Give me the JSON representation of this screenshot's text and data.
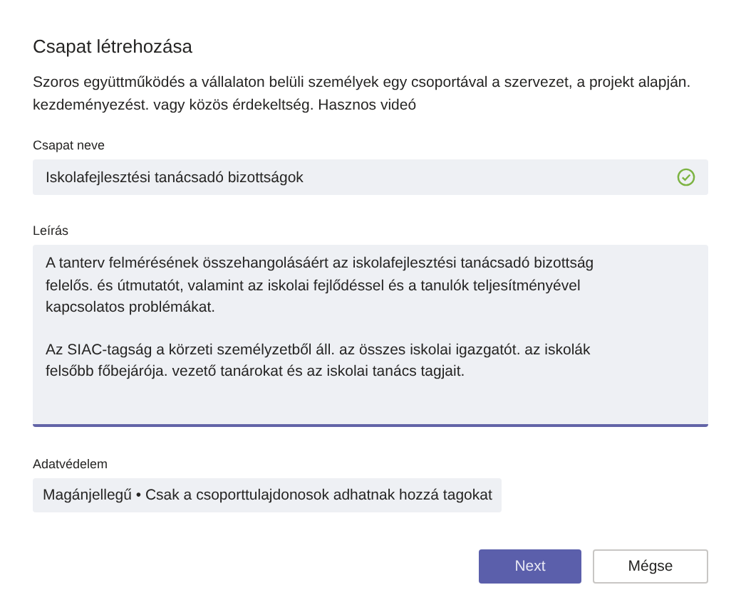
{
  "title": "Csapat létrehozása",
  "intro": "Szoros együttműködés a vállalaton belüli személyek egy csoportával a szervezet, a projekt alapján. kezdeményezést. vagy közös érdekeltség. Hasznos videó",
  "name_field": {
    "label": "Csapat neve",
    "value": "Iskolafejlesztési tanácsadó bizottságok",
    "valid": true
  },
  "description_field": {
    "label": "Leírás",
    "paragraphs": [
      "A tanterv felmérésének összehangolásáért az iskolafejlesztési tanácsadó bizottság felelős. és útmutatót, valamint az iskolai fejlődéssel és a tanulók teljesítményével kapcsolatos problémákat.",
      "Az SIAC-tagság a körzeti személyzetből áll. az összes iskolai igazgatót. az iskolák felsőbb főbejárója. vezető tanárokat és az iskolai tanács tagjait."
    ],
    "focused": true
  },
  "privacy_field": {
    "label": "Adatvédelem",
    "value": "Magánjellegű • Csak a csoporttulajdonosok adhatnak hozzá tagokat"
  },
  "buttons": [
    {
      "label": "Next",
      "kind": "primary"
    },
    {
      "label": "Mégse",
      "kind": "secondary"
    }
  ]
}
